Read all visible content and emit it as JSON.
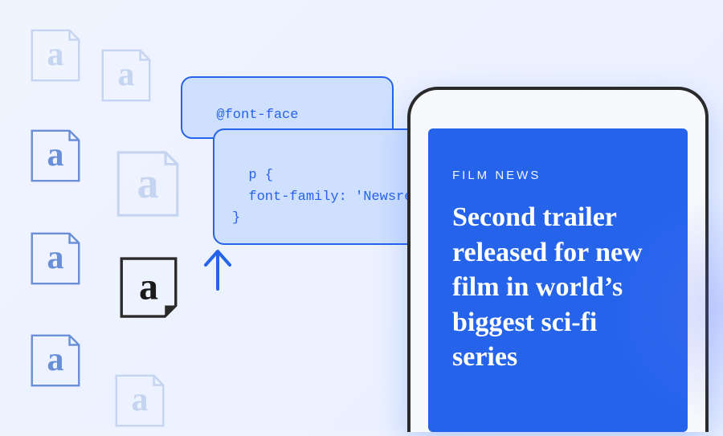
{
  "icons": {
    "letter": "a"
  },
  "code": {
    "box1": "@font-face",
    "box2": "p {\n  font-family: 'Newsrea\n}"
  },
  "phone": {
    "category": "FILM NEWS",
    "headline": "Second trailer released for new film in world’s biggest sci-fi series"
  }
}
